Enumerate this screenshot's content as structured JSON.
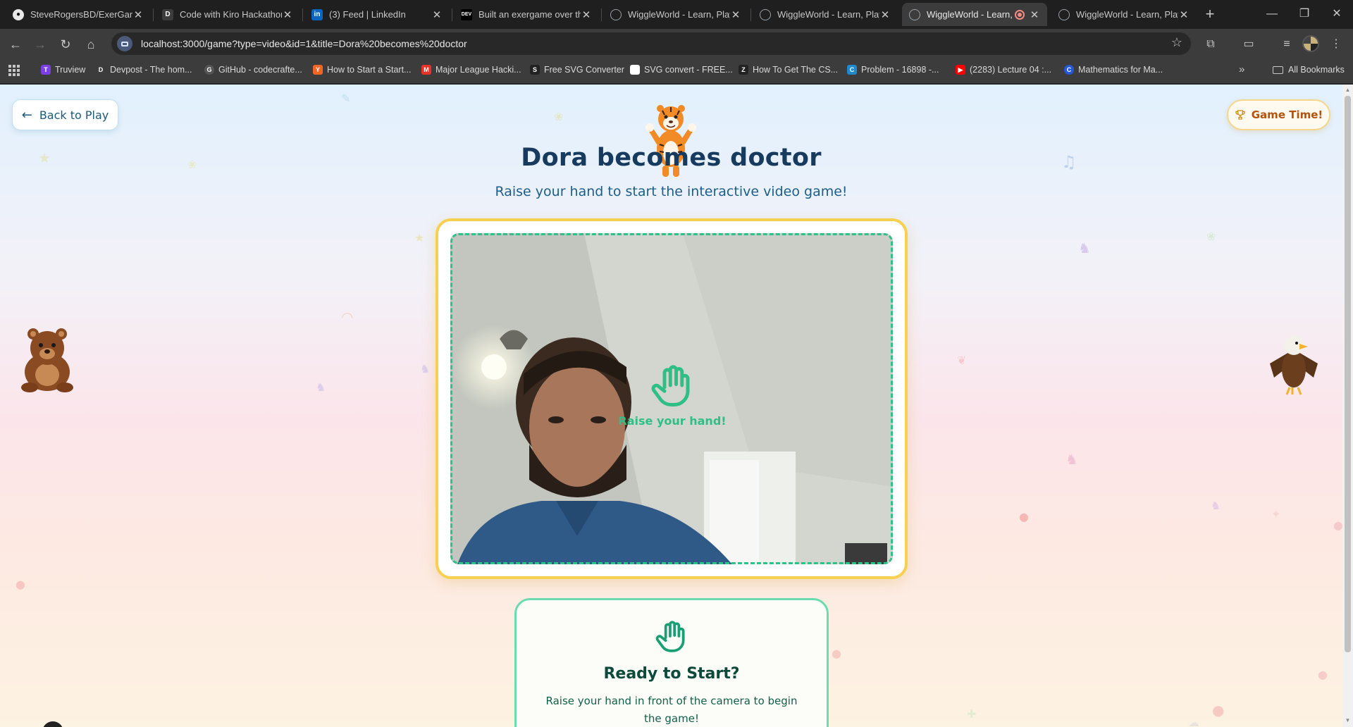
{
  "browser": {
    "tabs": [
      {
        "title": "SteveRogersBD/ExerGame",
        "favicon": "github-icon"
      },
      {
        "title": "Code with Kiro Hackathon",
        "favicon": "devpost-icon"
      },
      {
        "title": "(3) Feed | LinkedIn",
        "favicon": "linkedin-icon"
      },
      {
        "title": "Built an exergame over th",
        "favicon": "dev-icon"
      },
      {
        "title": "WiggleWorld - Learn, Play",
        "favicon": "globe-icon"
      },
      {
        "title": "WiggleWorld - Learn, Play",
        "favicon": "globe-icon"
      },
      {
        "title": "WiggleWorld - Learn, F",
        "favicon": "globe-icon",
        "active": true
      },
      {
        "title": "WiggleWorld - Learn, Play",
        "favicon": "globe-icon"
      }
    ],
    "url": "localhost:3000/game?type=video&id=1&title=Dora%20becomes%20doctor",
    "bookmarks": [
      {
        "label": "Truview",
        "color": "#7b3fe4",
        "glyph": "T"
      },
      {
        "label": "Devpost - The hom...",
        "color": "#3c3c3c",
        "glyph": "D"
      },
      {
        "label": "GitHub - codecrafte...",
        "color": "#555555",
        "glyph": "G"
      },
      {
        "label": "How to Start a Start...",
        "color": "#f26522",
        "glyph": "Y"
      },
      {
        "label": "Major League Hacki...",
        "color": "#e73427",
        "glyph": "M"
      },
      {
        "label": "Free SVG Converter",
        "color": "#222222",
        "glyph": "S"
      },
      {
        "label": "SVG convert - FREE...",
        "color": "#ffffff",
        "glyph": ""
      },
      {
        "label": "How To Get The CS...",
        "color": "#222222",
        "glyph": "Z"
      },
      {
        "label": "Problem - 16898 -...",
        "color": "#1f8acb",
        "glyph": "C"
      },
      {
        "label": "(2283) Lecture 04 :...",
        "color": "#ff0000",
        "glyph": "▶"
      },
      {
        "label": "Mathematics for Ma...",
        "color": "#2458d6",
        "glyph": "C"
      }
    ],
    "all_bookmarks": "All Bookmarks"
  },
  "page": {
    "back_label": "Back to Play",
    "game_time_label": "Game Time!",
    "title": "Dora becomes doctor",
    "subtitle": "Raise your hand to start the interactive video game!",
    "overlay_text": "Raise your hand!",
    "ready_title": "Ready to Start?",
    "ready_text": "Raise your hand in front of the camera to begin the game!"
  },
  "colors": {
    "accent_green": "#2cc28a",
    "frame_yellow": "#f8d04f",
    "title_navy": "#173b5f",
    "game_time_orange": "#b4530a"
  }
}
